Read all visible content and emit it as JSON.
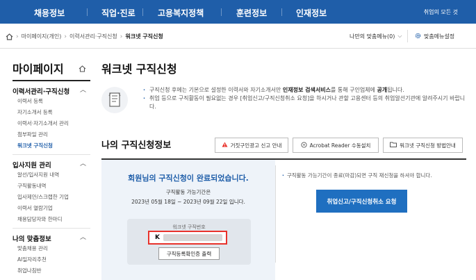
{
  "gnb": {
    "items": [
      "채용정보",
      "직업·진로",
      "고용복지정책",
      "훈련정보",
      "인재정보"
    ],
    "right": "취업의 모든 것"
  },
  "breadcrumb": {
    "items": [
      "마이페이지(개인)",
      "이력서관리·구직신청",
      "워크넷 구직신청"
    ],
    "my_menu": "나만의 맞춤메뉴(0)",
    "menu_settings": "맞춤메뉴설정"
  },
  "sidebar": {
    "title": "마이페이지",
    "sections": [
      {
        "label": "이력서관리·구직신청",
        "items": [
          "이력서 등록",
          "자기소개서 등록",
          "이력서·자기소개서 관리",
          "첨부파일 관리",
          "워크넷 구직신청"
        ],
        "active": 4
      },
      {
        "label": "입사지원 관리",
        "items": [
          "알선/입사지원 내역",
          "구직활동내역",
          "입사제안/스크랩한 기업",
          "이력서 열람기업",
          "채용담당자와 한마디"
        ],
        "active": -1
      },
      {
        "label": "나의 맞춤정보",
        "items": [
          "맞춤채용 관리",
          "AI일자리추천",
          "취업나침반"
        ],
        "active": -1
      }
    ]
  },
  "main": {
    "title": "워크넷 구직신청",
    "info": {
      "line1_pre": "구직신청 후에는 기본으로 설정한 이력서와 자기소개서만 ",
      "line1_bold1": "인재정보 검색서비스",
      "line1_mid": "를 통해 구인업체에 ",
      "line1_bold2": "공개",
      "line1_post": "됩니다.",
      "line2": "취업 등으로 구직활동이 필요없는 경우 [취업신고/구직신청취소 요청]을 하시거나 관할 고용센터 등의 취업알선기관에 알려주시기 바랍니다."
    },
    "sub_title": "나의 구직신청정보",
    "buttons": {
      "report": "거짓구인광고 신고 안내",
      "acrobat": "Acrobat Reader 수동설치",
      "guide": "워크넷 구직신청 방법안내"
    },
    "status": {
      "done": "회원님의 구직신청이 완료되었습니다.",
      "period_label": "구직활동 가능기간은",
      "period": "2023년 05월 18일 ~ 2023년 09월 22일 입니다.",
      "number_label": "워크넷 구직번호",
      "number_prefix": "K",
      "print_btn": "구직등록확인증 출력",
      "right_note": "구직활동 가능기간이 종료(마감)되면 구직 재신청을 하셔야 합니다.",
      "cancel_btn": "취업신고/구직신청취소 요청"
    }
  },
  "colors": {
    "brand": "#1f5ea9",
    "highlight": "#e8322b"
  }
}
